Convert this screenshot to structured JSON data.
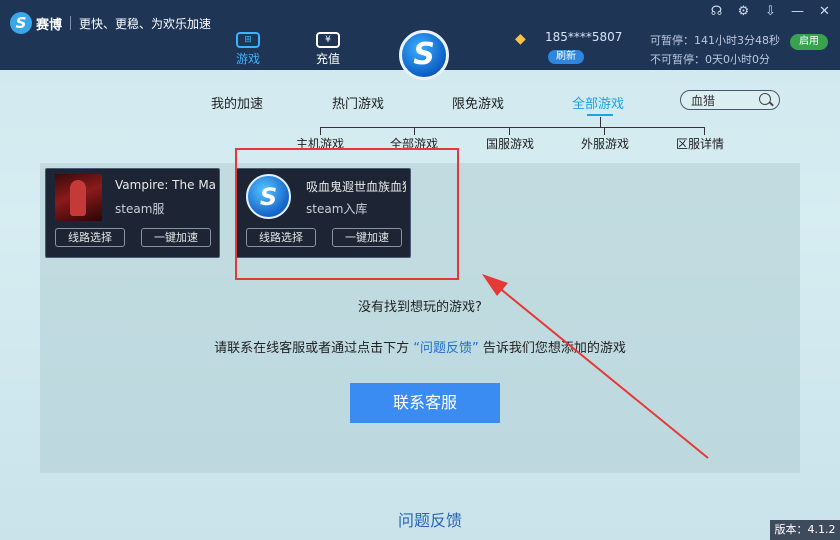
{
  "brand": {
    "logo_glyph": "S",
    "name": "赛博",
    "slogan": "更快、更稳、为欢乐加速"
  },
  "nav": [
    {
      "label": "游戏",
      "icon_text": "⊞",
      "active": true
    },
    {
      "label": "充值",
      "icon_text": "¥",
      "active": false
    }
  ],
  "center_logo": "S",
  "account": {
    "phone": "185****5807",
    "refresh_label": "刷新"
  },
  "time": {
    "pausable": "可暂停：141小时3分48秒",
    "non_pausable": "不可暂停：0天0小时0分"
  },
  "enable_label": "启用",
  "window_icons": [
    "headset-icon",
    "gear-icon",
    "download-icon",
    "minimize-icon",
    "close-icon"
  ],
  "category_tabs": [
    "我的加速",
    "热门游戏",
    "限免游戏",
    "全部游戏"
  ],
  "active_category": "全部游戏",
  "search": {
    "value": "血猎"
  },
  "sub_tabs": [
    "主机游戏",
    "全部游戏",
    "国服游戏",
    "外服游戏",
    "区服详情"
  ],
  "games": [
    {
      "title": "Vampire: The Ma",
      "subtitle": "steam服",
      "route_label": "线路选择",
      "boost_label": "一键加速"
    },
    {
      "title": "吸血鬼遐世血族血猎",
      "subtitle": "steam入库",
      "route_label": "线路选择",
      "boost_label": "一键加速"
    }
  ],
  "notfound_text": "没有找到想玩的游戏?",
  "contact": {
    "prefix": "请联系在线客服或者通过点击下方",
    "link": "“问题反馈”",
    "suffix": "告诉我们您想添加的游戏"
  },
  "service_button": "联系客服",
  "feedback_link": "问题反馈",
  "version": "版本：4.1.2",
  "colors": {
    "topbar": "#1e3556",
    "accent": "#1fa1e6",
    "highlight": "#e53935",
    "button": "#3a8cf2"
  }
}
